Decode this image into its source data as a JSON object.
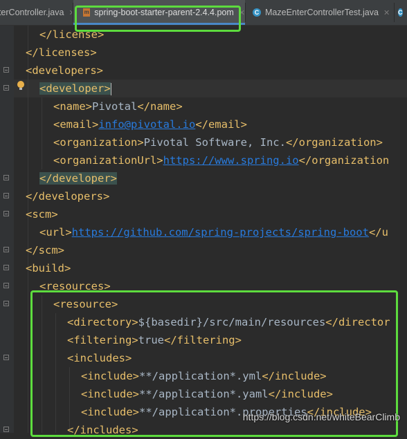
{
  "tabs": [
    {
      "label": "nterController.java",
      "icon": "java-class-icon",
      "active": false
    },
    {
      "label": "spring-boot-starter-parent-2.4.4.pom",
      "icon": "maven-pom-icon",
      "active": true
    },
    {
      "label": "MazeEnterControllerTest.java",
      "icon": "java-class-icon",
      "active": false
    },
    {
      "label": "B",
      "icon": "java-class-icon",
      "active": false
    }
  ],
  "icons": {
    "class_glyph": "C",
    "maven_glyph": "m"
  },
  "editor": {
    "lines": [
      [
        {
          "t": "</license>"
        }
      ],
      [
        {
          "t": "</licenses>"
        }
      ],
      [
        {
          "t": "<developers>"
        }
      ],
      [
        {
          "t": "<developer>",
          "c": "tagbg"
        }
      ],
      [
        {
          "t": "<name>"
        },
        {
          "t": "Pivotal",
          "c": "txt"
        },
        {
          "t": "</name>"
        }
      ],
      [
        {
          "t": "<email>"
        },
        {
          "t": "info@pivotal.io",
          "c": "link"
        },
        {
          "t": "</email>"
        }
      ],
      [
        {
          "t": "<organization>"
        },
        {
          "t": "Pivotal Software, Inc.",
          "c": "txt"
        },
        {
          "t": "</organization>"
        }
      ],
      [
        {
          "t": "<organizationUrl>"
        },
        {
          "t": "https://www.spring.io",
          "c": "link"
        },
        {
          "t": "</organization"
        }
      ],
      [
        {
          "t": "</developer>",
          "c": "tagbg"
        }
      ],
      [
        {
          "t": "</developers>"
        }
      ],
      [
        {
          "t": "<scm>"
        }
      ],
      [
        {
          "t": "<url>"
        },
        {
          "t": "https://github.com/spring-projects/spring-boot",
          "c": "link"
        },
        {
          "t": "</u"
        }
      ],
      [
        {
          "t": "</scm>"
        }
      ],
      [
        {
          "t": "<build>"
        }
      ],
      [
        {
          "t": "<resources>"
        }
      ],
      [
        {
          "t": "<resource>"
        }
      ],
      [
        {
          "t": "<directory>"
        },
        {
          "t": "${basedir}/src/main/resources",
          "c": "txt"
        },
        {
          "t": "</director"
        }
      ],
      [
        {
          "t": "<filtering>"
        },
        {
          "t": "true",
          "c": "txt"
        },
        {
          "t": "</filtering>"
        }
      ],
      [
        {
          "t": "<includes>"
        }
      ],
      [
        {
          "t": "<include>"
        },
        {
          "t": "**/application*.yml",
          "c": "txt"
        },
        {
          "t": "</include>"
        }
      ],
      [
        {
          "t": "<include>"
        },
        {
          "t": "**/application*.yaml",
          "c": "txt"
        },
        {
          "t": "</include>"
        }
      ],
      [
        {
          "t": "<include>"
        },
        {
          "t": "**/application*.properties",
          "c": "txt"
        },
        {
          "t": "</include>"
        }
      ],
      [
        {
          "t": "</includes>"
        }
      ]
    ]
  },
  "watermark": "https://blog.csdn.net/whiteBearClimb",
  "colors": {
    "background": "#2b2b2b",
    "tag": "#e8bf6a",
    "text": "#a9b7c6",
    "link": "#287bde",
    "tag_match_highlight": "#3b514d",
    "annotation_box": "#5ddc3e",
    "active_tab_underline": "#4a88c7"
  }
}
